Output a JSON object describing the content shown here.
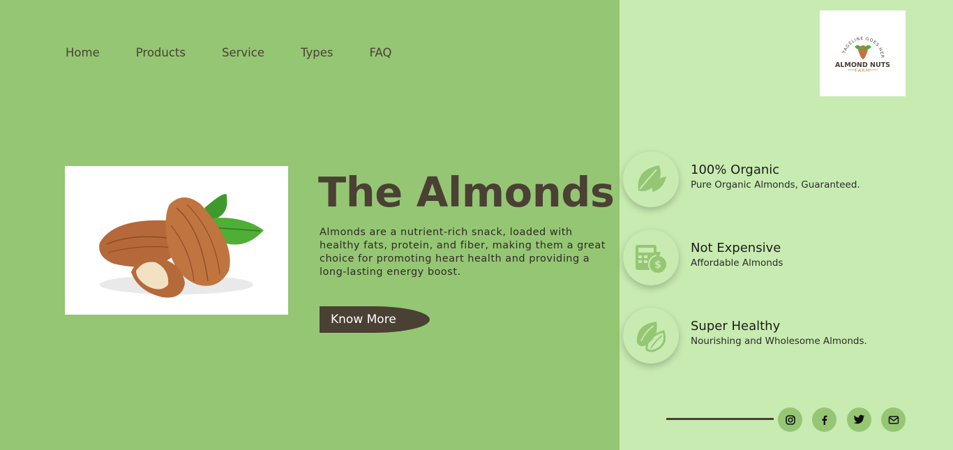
{
  "nav": {
    "items": [
      {
        "label": "Home"
      },
      {
        "label": "Products"
      },
      {
        "label": "Service"
      },
      {
        "label": "Types"
      },
      {
        "label": "FAQ"
      }
    ]
  },
  "hero": {
    "title": "The Almonds",
    "description": "Almonds are a nutrient-rich snack, loaded with healthy fats, protein, and fiber, making them a great choice for promoting heart health and providing a long-lasting energy boost.",
    "cta_label": "Know More",
    "image_icon": "almonds-photo"
  },
  "logo": {
    "tagline": "TAGELINE GOES HERE",
    "name_line1": "ALMOND NUTS",
    "name_line2": "FARM"
  },
  "features": [
    {
      "icon": "leaf-icon",
      "title": "100% Organic",
      "subtitle": "Pure Organic Almonds, Guaranteed."
    },
    {
      "icon": "calculator-money-icon",
      "title": "Not Expensive",
      "subtitle": "Affordable Almonds"
    },
    {
      "icon": "almond-icon",
      "title": "Super Healthy",
      "subtitle": "Nourishing and Wholesome Almonds."
    }
  ],
  "social": [
    {
      "icon": "instagram-icon"
    },
    {
      "icon": "facebook-icon"
    },
    {
      "icon": "twitter-icon"
    },
    {
      "icon": "email-icon"
    }
  ],
  "colors": {
    "left_panel": "#95c674",
    "right_panel": "#c8ebb1",
    "brand_brown": "#4a4034",
    "logo_orange": "#d98a3b"
  }
}
